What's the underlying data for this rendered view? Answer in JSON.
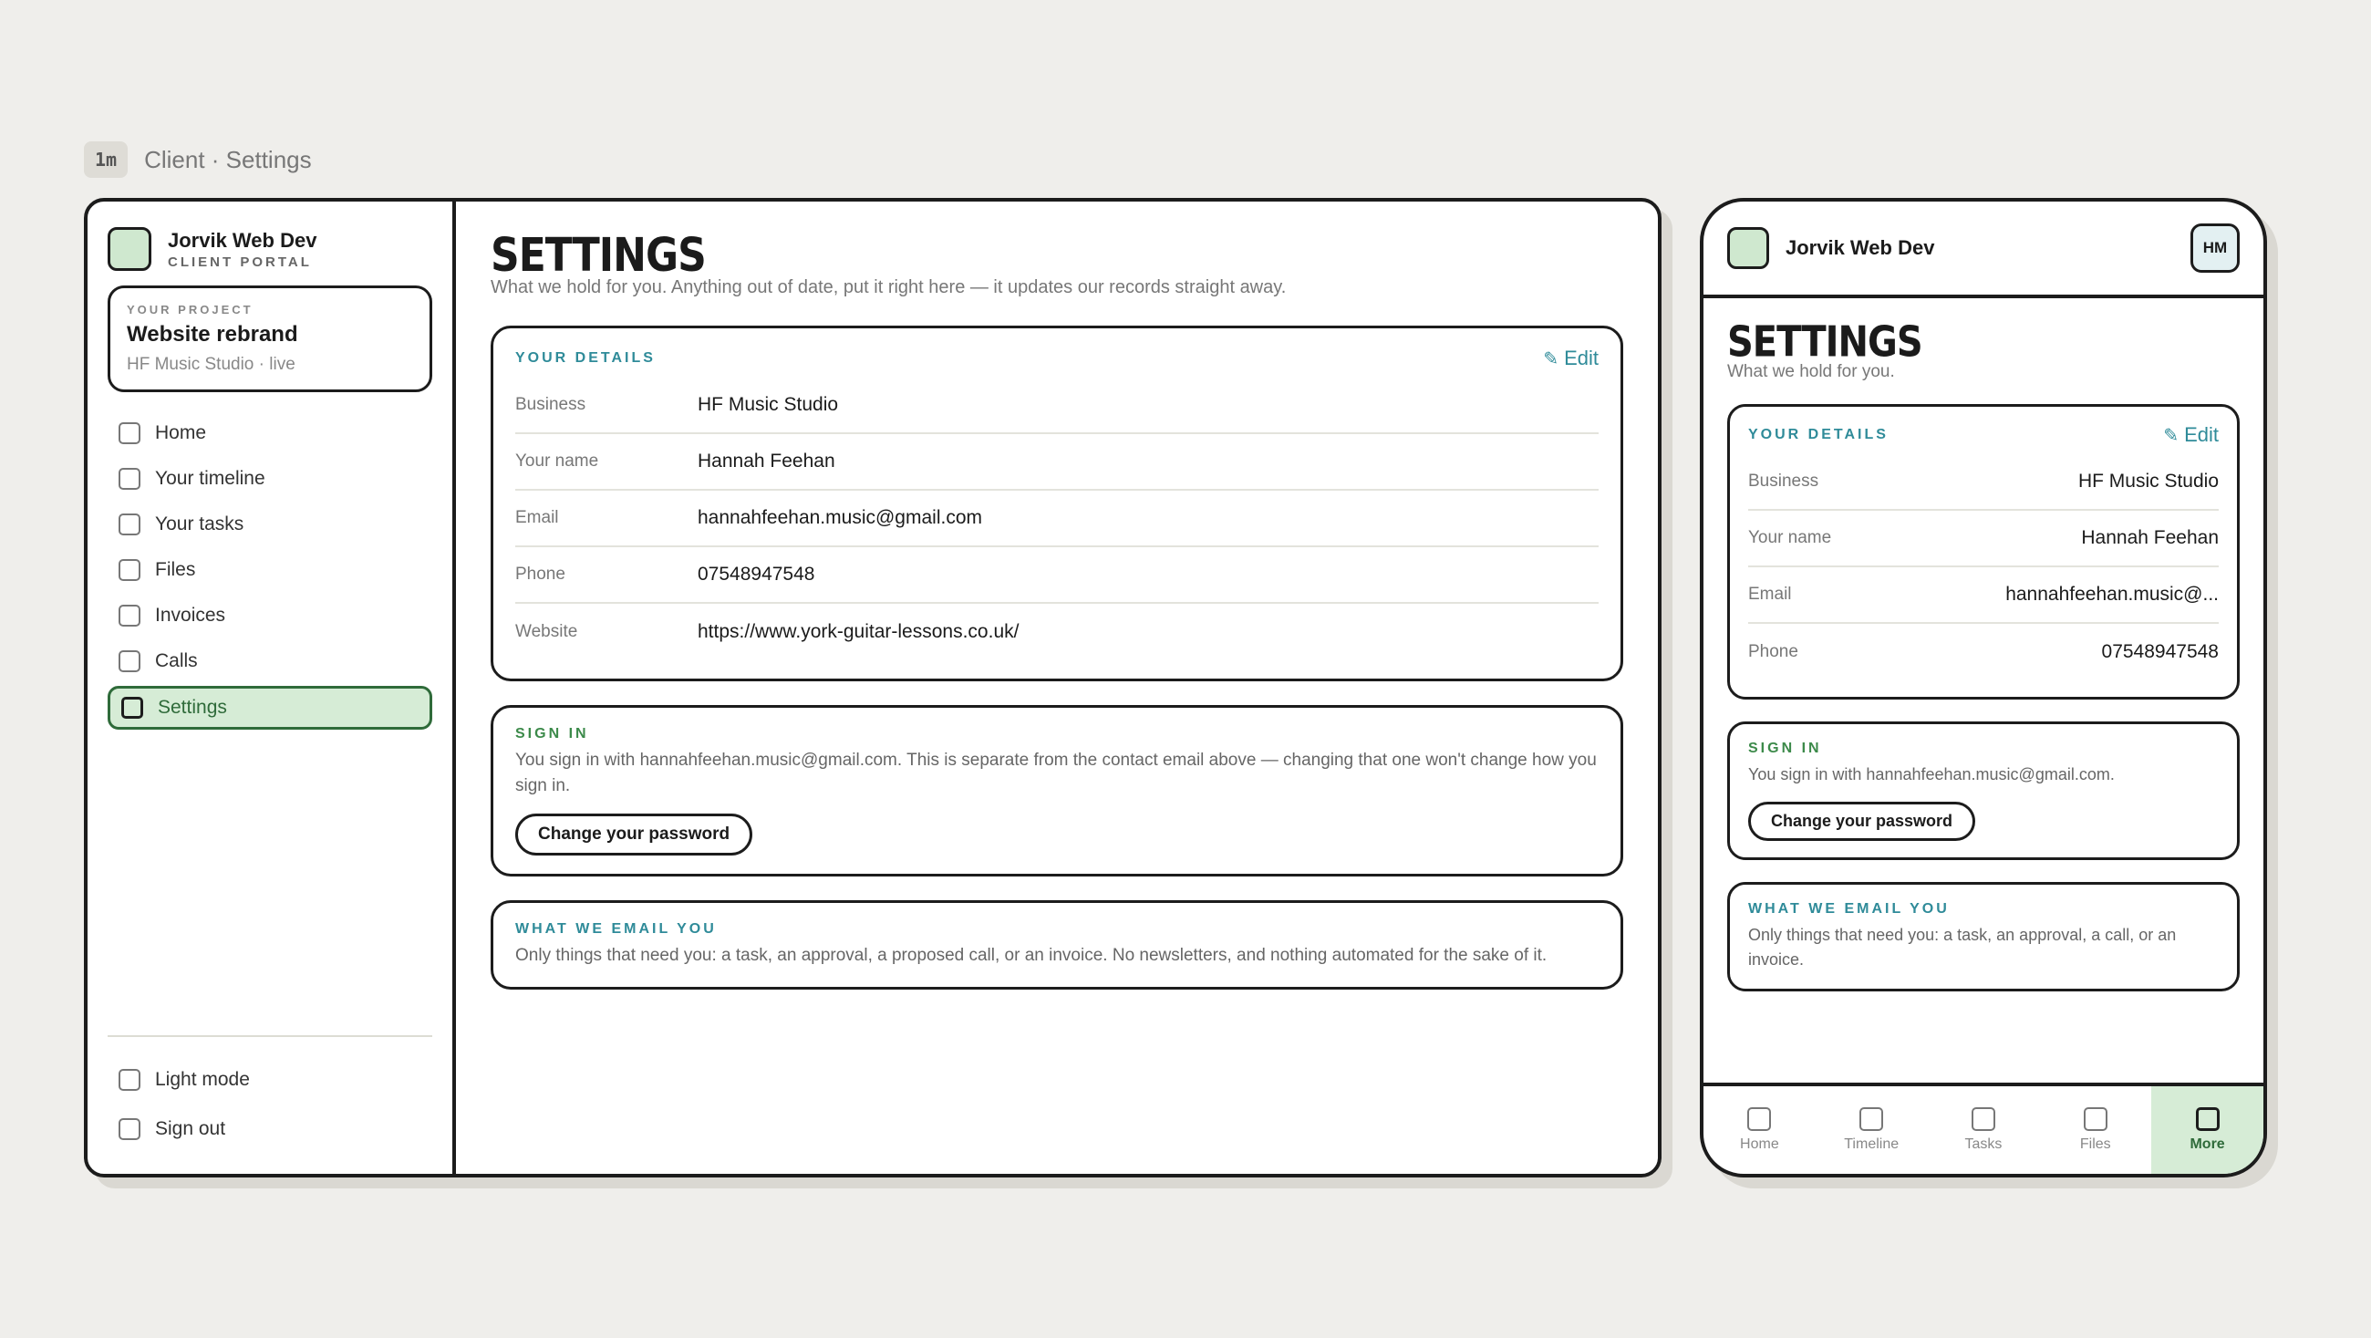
{
  "screen": {
    "code": "1m",
    "title": "Client · Settings"
  },
  "brand": {
    "name": "Jorvik Web Dev",
    "subtitle": "CLIENT PORTAL"
  },
  "project": {
    "label": "YOUR PROJECT",
    "name": "Website rebrand",
    "meta": "HF Music Studio · live"
  },
  "nav": {
    "items": [
      "Home",
      "Your timeline",
      "Your tasks",
      "Files",
      "Invoices",
      "Calls",
      "Settings"
    ],
    "active": "Settings",
    "bottom": [
      "Light mode",
      "Sign out"
    ]
  },
  "page": {
    "title": "SETTINGS",
    "subtitle": "What we hold for you. Anything out of date, put it right here — it updates our records straight away.",
    "mobile_subtitle": "What we hold for you."
  },
  "details": {
    "label": "YOUR DETAILS",
    "edit": "Edit",
    "rows": [
      {
        "key": "Business",
        "value": "HF Music Studio"
      },
      {
        "key": "Your name",
        "value": "Hannah Feehan"
      },
      {
        "key": "Email",
        "value": "hannahfeehan.music@gmail.com"
      },
      {
        "key": "Phone",
        "value": "07548947548"
      },
      {
        "key": "Website",
        "value": "https://www.york-guitar-lessons.co.uk/"
      }
    ],
    "mobile_email": "hannahfeehan.music@..."
  },
  "signin": {
    "label": "SIGN IN",
    "text": "You sign in with hannahfeehan.music@gmail.com. This is separate from the contact email above — changing that one won't change how you sign in.",
    "mobile_text": "You sign in with hannahfeehan.music@gmail.com.",
    "button": "Change your password"
  },
  "emails": {
    "label": "WHAT WE EMAIL YOU",
    "text": "Only things that need you: a task, an approval, a proposed call, or an invoice. No newsletters, and nothing automated for the sake of it.",
    "mobile_text": "Only things that need you: a task, an approval, a call, or an invoice."
  },
  "mobile": {
    "avatar": "HM",
    "tabs": [
      "Home",
      "Timeline",
      "Tasks",
      "Files",
      "More"
    ],
    "active_tab": "More"
  },
  "colors": {
    "accent_green": "#d6ecd6",
    "accent_teal": "#2f8b99",
    "ink": "#1c1c1c"
  }
}
